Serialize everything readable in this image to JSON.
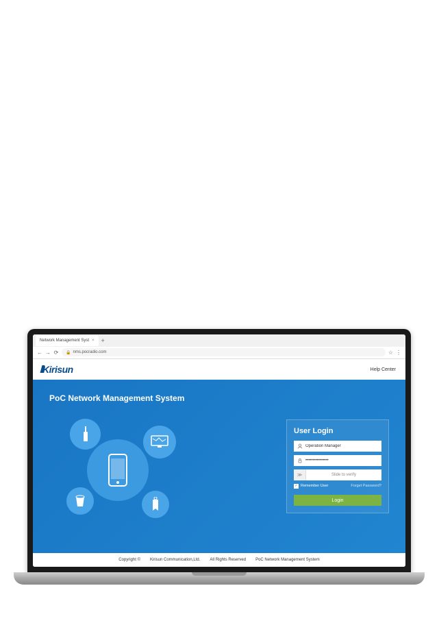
{
  "browser": {
    "tab_title": "Network Management Syst",
    "url": "nms.pocradio.com"
  },
  "header": {
    "logo_text": "Kirisun",
    "help_link": "Help Center"
  },
  "hero": {
    "title": "PoC Network Management System"
  },
  "login": {
    "title": "User Login",
    "username_value": "Operation Manager",
    "password_value": "••••••••••••••••",
    "slide_label": "Slide to verify",
    "remember_label": "Remember User",
    "forgot_label": "Forget Password?",
    "button_label": "Login"
  },
  "footer": {
    "copyright": "Copyright ©",
    "company": "Kirisun Communication,Ltd.",
    "rights": "All Rights Reserved",
    "product": "PoC Network Management System"
  }
}
